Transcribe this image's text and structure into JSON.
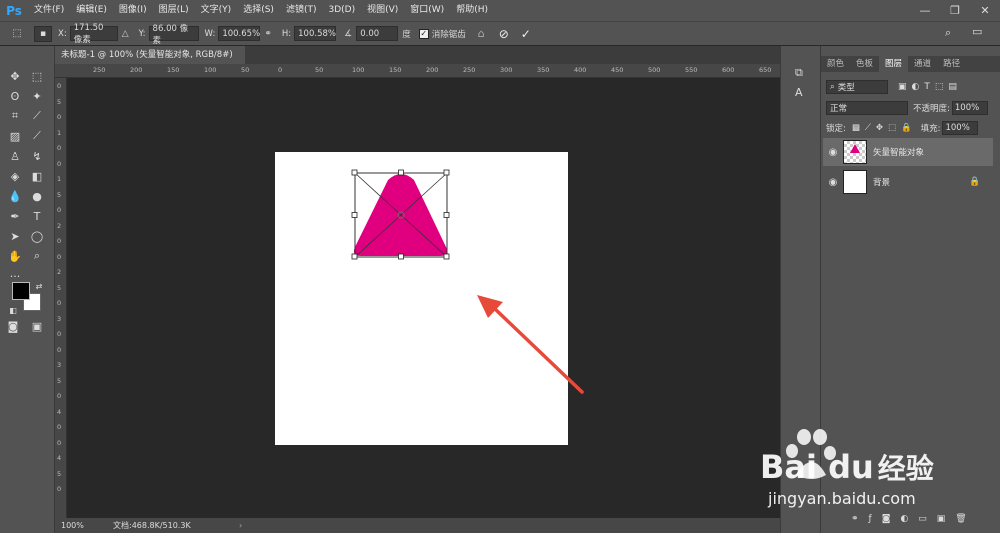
{
  "app": {
    "logo": "Ps"
  },
  "menu": [
    "文件(F)",
    "编辑(E)",
    "图像(I)",
    "图层(L)",
    "文字(Y)",
    "选择(S)",
    "滤镜(T)",
    "3D(D)",
    "视图(V)",
    "窗口(W)",
    "帮助(H)"
  ],
  "options": {
    "x_label": "X:",
    "x_value": "171.50 像素",
    "y_label": "Y:",
    "y_value": "86.00 像素",
    "w_label": "W:",
    "w_value": "100.65%",
    "h_label": "H:",
    "h_value": "100.58%",
    "angle_value": "0.00",
    "angle_unit": "度",
    "antialias_label": "消除锯齿"
  },
  "document": {
    "tab_title": "未标题-1 @ 100% (矢量智能对象, RGB/8#)",
    "close": "×"
  },
  "ruler_top": [
    "250",
    "200",
    "150",
    "100",
    "50",
    "0",
    "50",
    "100",
    "150",
    "200",
    "250",
    "300",
    "350",
    "400",
    "450",
    "500",
    "550",
    "600",
    "650"
  ],
  "ruler_left": [
    "0",
    "5",
    "0",
    "1",
    "0",
    "0",
    "1",
    "5",
    "0",
    "2",
    "0",
    "0",
    "2",
    "5",
    "0",
    "3",
    "0",
    "0",
    "3",
    "5",
    "0",
    "4",
    "0",
    "0",
    "4",
    "5",
    "0"
  ],
  "status": {
    "zoom": "100%",
    "doc_info": "文档:468.8K/510.3K",
    "arrow": "›"
  },
  "panel": {
    "tabs": [
      "颜色",
      "色板",
      "图层",
      "通道",
      "路径"
    ],
    "active_tab": "图层",
    "filter_label": "类型",
    "blend_mode": "正常",
    "opacity_label": "不透明度:",
    "opacity_value": "100%",
    "lock_label": "锁定:",
    "fill_label": "填充:",
    "fill_value": "100%",
    "layers": [
      {
        "name": "矢量智能对象",
        "selected": true
      },
      {
        "name": "背景",
        "selected": false,
        "locked": true
      }
    ]
  },
  "watermark": {
    "brand": "Bai",
    "brand2": "du",
    "cn": "经验",
    "url": "jingyan.baidu.com"
  },
  "colors": {
    "shape": "#e0007f",
    "arrow": "#e84a3a",
    "ui": "#535353"
  }
}
